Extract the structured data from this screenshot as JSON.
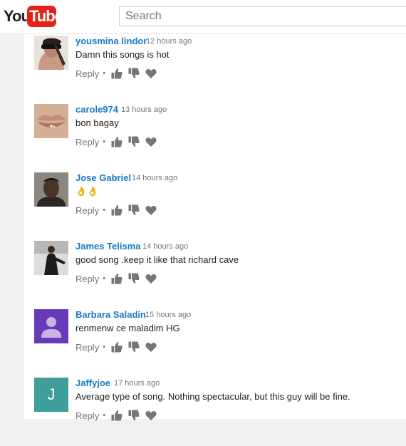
{
  "header": {
    "logo_you": "You",
    "logo_tube": "Tube",
    "search_placeholder": "Search"
  },
  "comments": [
    {
      "author": "yousmina lindor",
      "time": "12 hours ago",
      "text": "Damn this songs is hot",
      "reply_label": "Reply"
    },
    {
      "author": "carole974",
      "time": "13 hours ago",
      "text": "bon bagay",
      "reply_label": "Reply"
    },
    {
      "author": "Jose Gabriel",
      "time": "14 hours ago",
      "text": "👌👌",
      "reply_label": "Reply"
    },
    {
      "author": "James Telisma",
      "time": "14 hours ago",
      "text": "good song .keep it like that richard cave",
      "reply_label": "Reply"
    },
    {
      "author": "Barbara Saladin",
      "time": "15 hours ago",
      "text": "renmenw ce maladim  HG",
      "reply_label": "Reply"
    },
    {
      "author": "Jaffyjoe",
      "time": "17 hours ago",
      "text": "Average type of song. Nothing spectacular, but this guy will be fine.",
      "reply_label": "Reply",
      "avatar_letter": "J"
    }
  ],
  "colors": {
    "brand_red": "#e62117",
    "author_link": "#167ac6",
    "action_gray": "#767676",
    "avatar_purple": "#673ab7",
    "avatar_teal": "#3f9d9a"
  }
}
